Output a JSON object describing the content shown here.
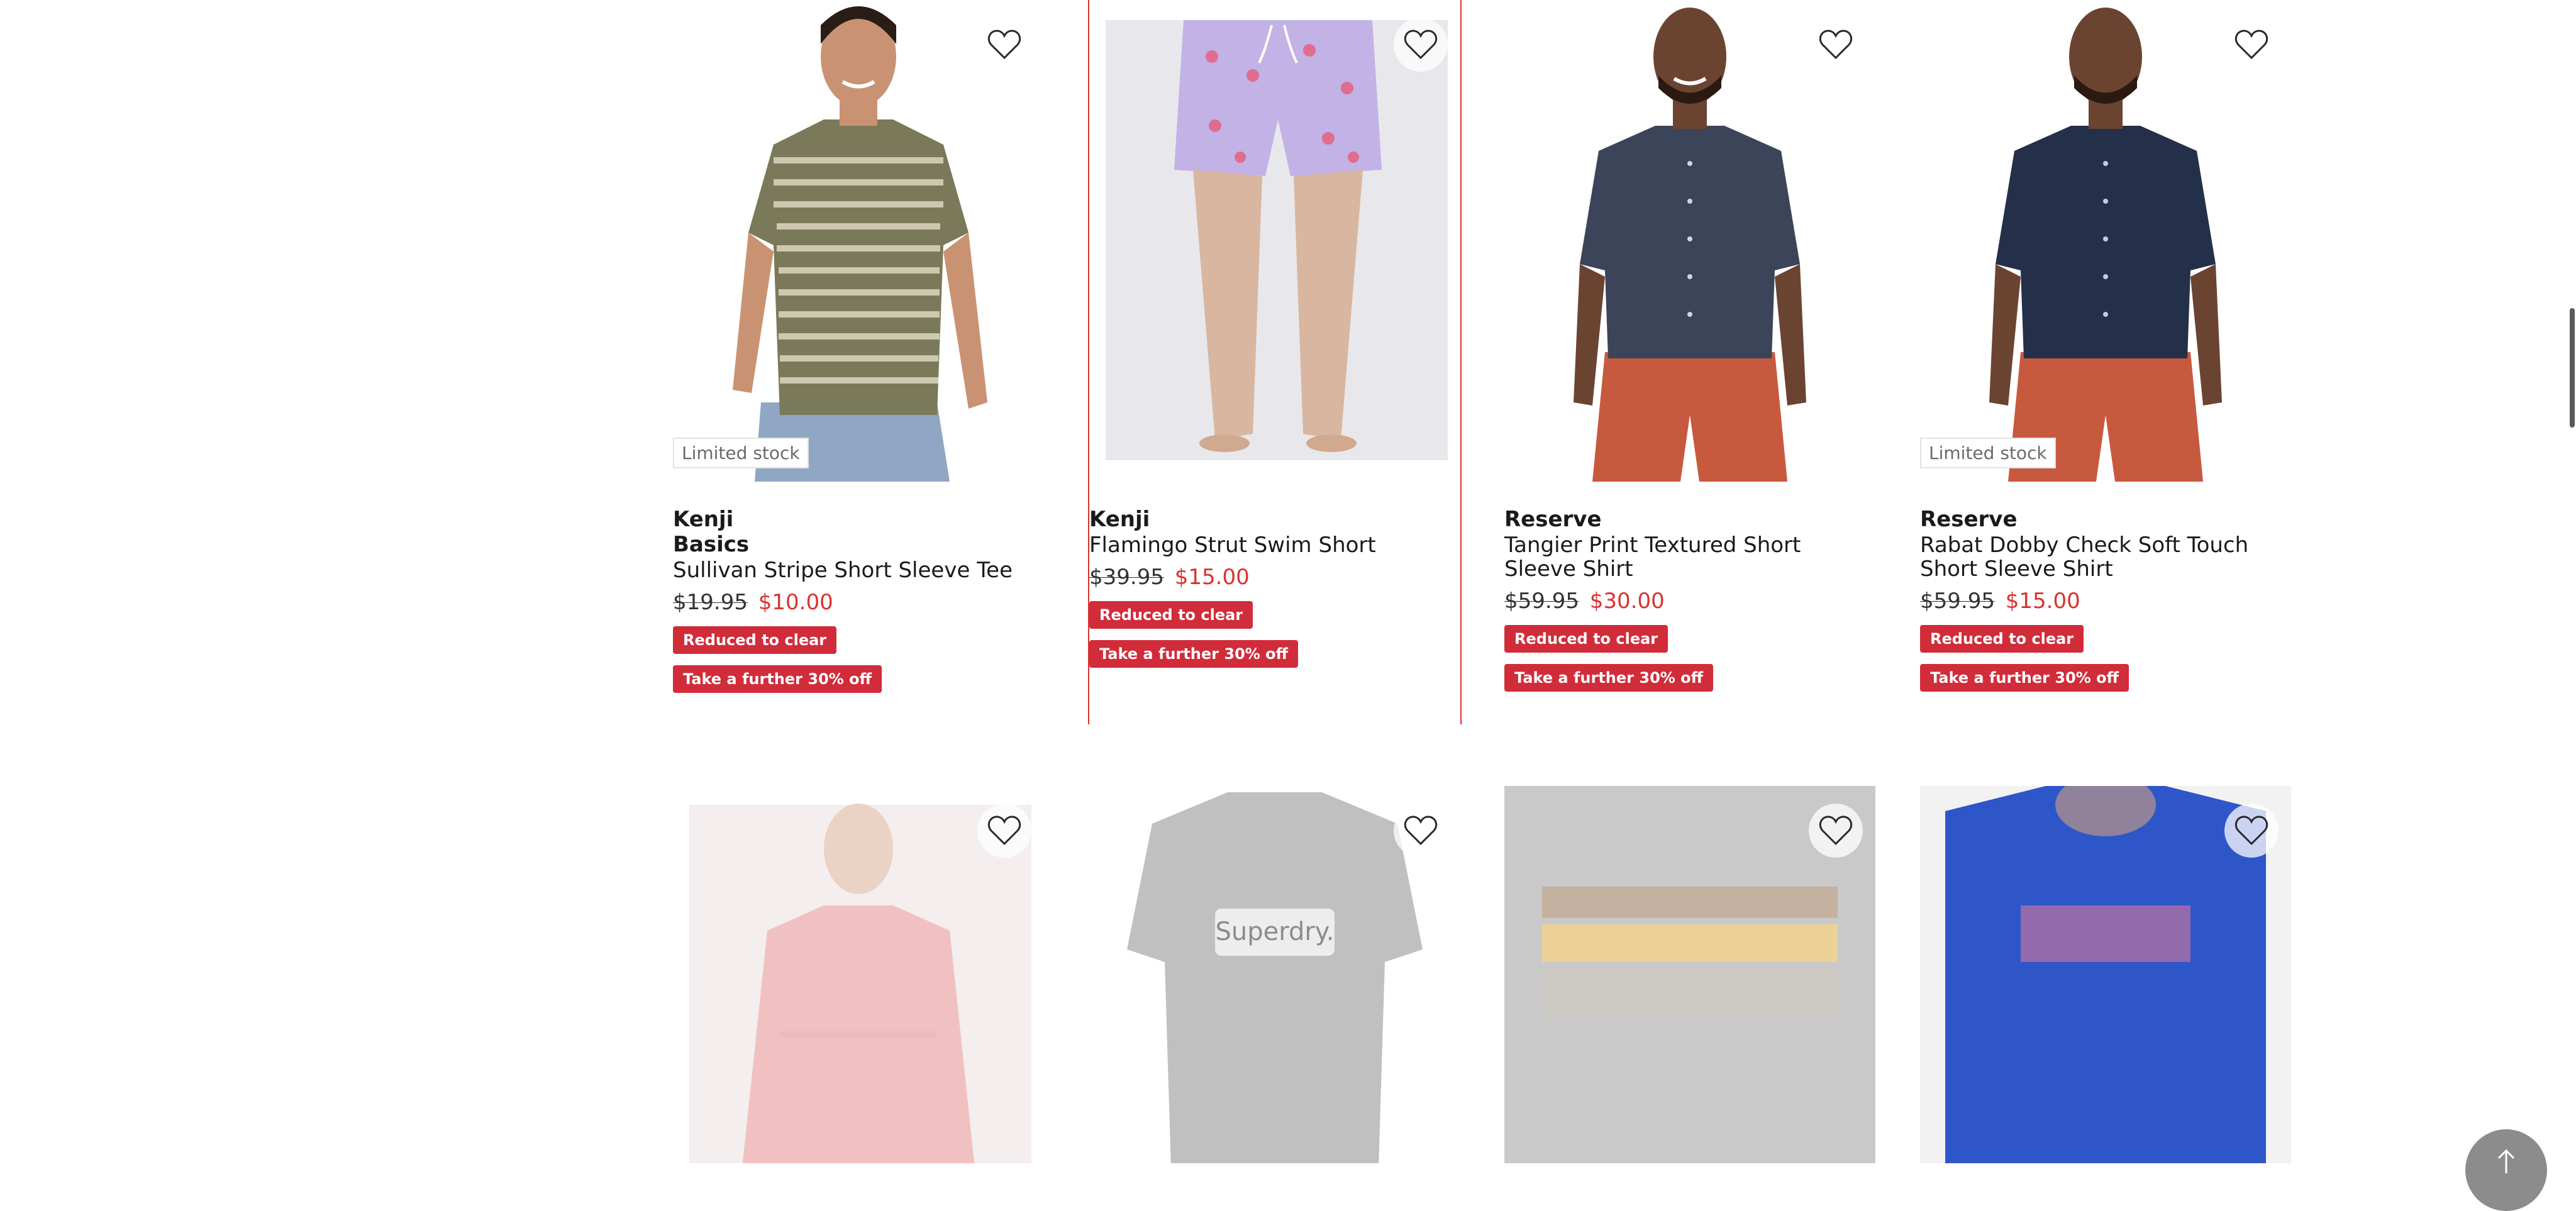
{
  "colors": {
    "sale_price": "#d9322f",
    "promo_tag": "#d12c3a",
    "selected_outline": "#d9322f"
  },
  "products": [
    {
      "brand": "Kenji",
      "brand_line2": "Basics",
      "name": "Sullivan Stripe Short Sleeve Tee",
      "was_price": "$19.95",
      "now_price": "$10.00",
      "badge": "Limited stock",
      "tags": [
        "Reduced to clear",
        "Take a further 30% off"
      ]
    },
    {
      "brand": "Kenji",
      "name": "Flamingo Strut Swim Short",
      "was_price": "$39.95",
      "now_price": "$15.00",
      "tags": [
        "Reduced to clear",
        "Take a further 30% off"
      ]
    },
    {
      "brand": "Reserve",
      "name": "Tangier Print Textured Short Sleeve Shirt",
      "was_price": "$59.95",
      "now_price": "$30.00",
      "tags": [
        "Reduced to clear",
        "Take a further 30% off"
      ]
    },
    {
      "brand": "Reserve",
      "name": "Rabat Dobby Check Soft Touch Short Sleeve Shirt",
      "was_price": "$59.95",
      "now_price": "$15.00",
      "badge": "Limited stock",
      "tags": [
        "Reduced to clear",
        "Take a further 30% off"
      ]
    }
  ],
  "row2_images": [
    {
      "icon": "pink-long-sleeve-shirt-image"
    },
    {
      "icon": "black-superdry-tee-image",
      "print_text": "Superdry."
    },
    {
      "icon": "striped-tee-image"
    },
    {
      "icon": "blue-tee-image"
    }
  ],
  "icons": {
    "wishlist": "heart-icon",
    "back_to_top": "arrow-up-icon"
  }
}
